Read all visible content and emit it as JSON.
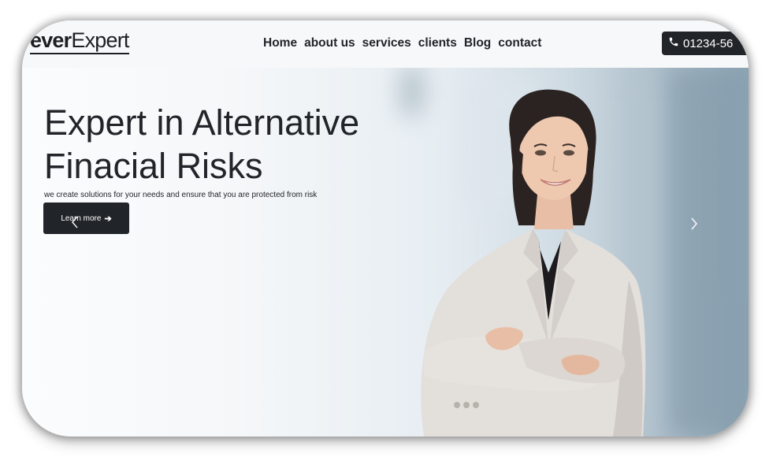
{
  "brand": {
    "logo_strong": "ever",
    "logo_light": "Expert"
  },
  "nav": {
    "links": [
      "Home",
      "about us",
      "services",
      "clients",
      "Blog",
      "contact"
    ],
    "phone": "01234-56"
  },
  "hero": {
    "title_line1": "Expert in Alternative",
    "title_line2": "Finacial Risks",
    "subtitle": "we create solutions for your needs and ensure that you are protected from risk",
    "cta_label": "Learn more",
    "cta_icon": "arrow-right-icon",
    "prev_icon": "chevron-left-icon",
    "next_icon": "chevron-right-icon"
  },
  "colors": {
    "dark": "#212529",
    "header_bg": "#f7f8f9"
  }
}
